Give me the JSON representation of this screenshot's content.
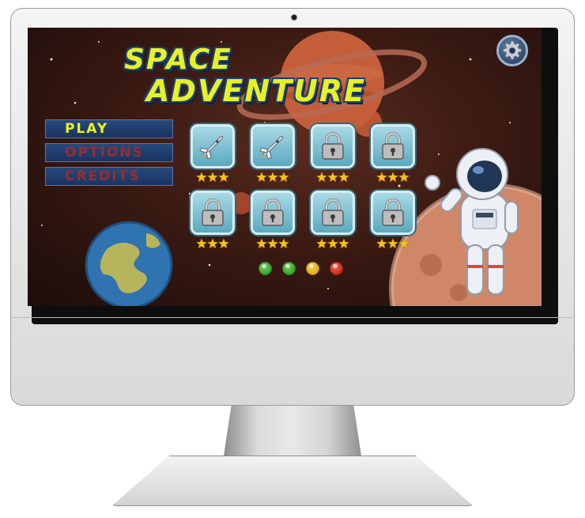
{
  "game": {
    "title_line1": "SPACE",
    "title_line2": "ADVENTURE"
  },
  "menu": {
    "items": [
      {
        "label": "PLAY",
        "state": "selected"
      },
      {
        "label": "OPTIONS",
        "state": "normal"
      },
      {
        "label": "CREDITS",
        "state": "normal"
      }
    ]
  },
  "settings": {
    "icon": "gear-icon"
  },
  "levels": [
    {
      "icon": "space-shuttle-icon",
      "locked": false,
      "stars": 3
    },
    {
      "icon": "space-shuttle-icon",
      "locked": false,
      "stars": 3
    },
    {
      "icon": "padlock-icon",
      "locked": true,
      "stars": 3
    },
    {
      "icon": "padlock-icon",
      "locked": true,
      "stars": 3
    },
    {
      "icon": "padlock-icon",
      "locked": true,
      "stars": 3
    },
    {
      "icon": "padlock-icon",
      "locked": true,
      "stars": 3
    },
    {
      "icon": "padlock-icon",
      "locked": true,
      "stars": 3
    },
    {
      "icon": "padlock-icon",
      "locked": true,
      "stars": 3
    }
  ],
  "pagination_dots": [
    {
      "color": "#3fae2a"
    },
    {
      "color": "#3fae2a"
    },
    {
      "color": "#e8b417"
    },
    {
      "color": "#d8301f"
    }
  ],
  "colors": {
    "title": "#e7f125",
    "title_outline": "#1b3f6e",
    "menu_selected": "#ecf21f",
    "menu_normal": "#9b2c2c",
    "menu_bg": "#1a3461",
    "level_tile": "#7fc3d4",
    "star": "#f6c21b"
  }
}
